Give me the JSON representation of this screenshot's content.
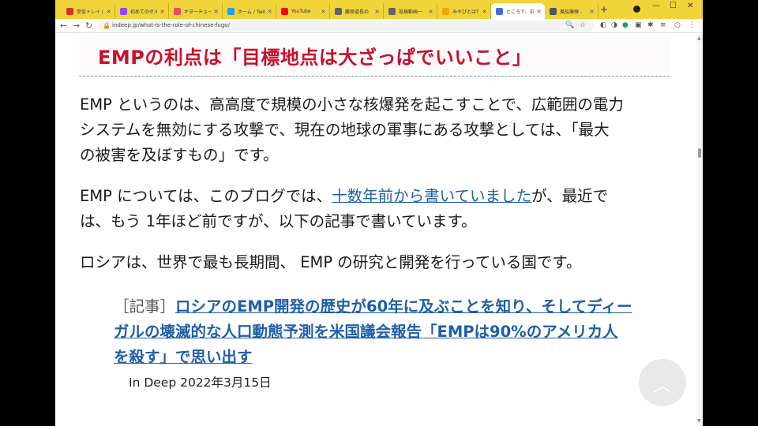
{
  "tabs": [
    {
      "label": "受信トレイ (",
      "color": "#d93025"
    },
    {
      "label": "初めてのゼル",
      "color": "#9146ff"
    },
    {
      "label": "ギターチューニ",
      "color": "#e94f64"
    },
    {
      "label": "ホーム / Twitt",
      "color": "#1da1f2"
    },
    {
      "label": "YouTube",
      "color": "#ff0000"
    },
    {
      "label": "藤原道長の",
      "color": "#5f6368"
    },
    {
      "label": "投稿動画一",
      "color": "#666666"
    },
    {
      "label": "みやびとは？",
      "color": "#f4a300"
    },
    {
      "label": "ところで、中国",
      "color": "#4a6fd1"
    },
    {
      "label": "風船爆弾 - ",
      "color": "#555555"
    }
  ],
  "active_tab": 8,
  "toolbar": {
    "back": "←",
    "forward": "→",
    "reload": "↻",
    "url": "indeep.jp/what-is-the-role-of-chinese-fugo/"
  },
  "article": {
    "heading": "EMPの利点は「目標地点は大ざっぱでいいこと」",
    "p1": [
      "EMP というのは、高高度で規模の小さな核爆発を起こすことで、広範囲の電力",
      "システムを無効にする攻撃で、現在の地球の軍事にある攻撃としては、「最大",
      "の被害を及ぼすもの」です。"
    ],
    "p2_before": "EMP については、このブログでは、",
    "p2_link": "十数年前から書いていました",
    "p2_after": "が、最近で",
    "p2_line2": "は、もう 1年ほど前ですが、以下の記事で書いています。",
    "p3": "ロシアは、世界で最も長期間、 EMP の研究と開発を行っている国です。",
    "related_tag": "［記事］",
    "related_link_lines": [
      "ロシアのEMP開発の歴史が60年に及ぶことを知り、そしてディー",
      "ガルの壊滅的な人口動態予測を米国議会報告「EMPは90%のアメリカ人",
      "を殺す」で思い出す"
    ],
    "related_meta": "In Deep 2022年3月15日"
  },
  "colors": {
    "tabstrip": "#f0d43a",
    "heading": "#c8102e",
    "link": "#1f5fa8"
  }
}
